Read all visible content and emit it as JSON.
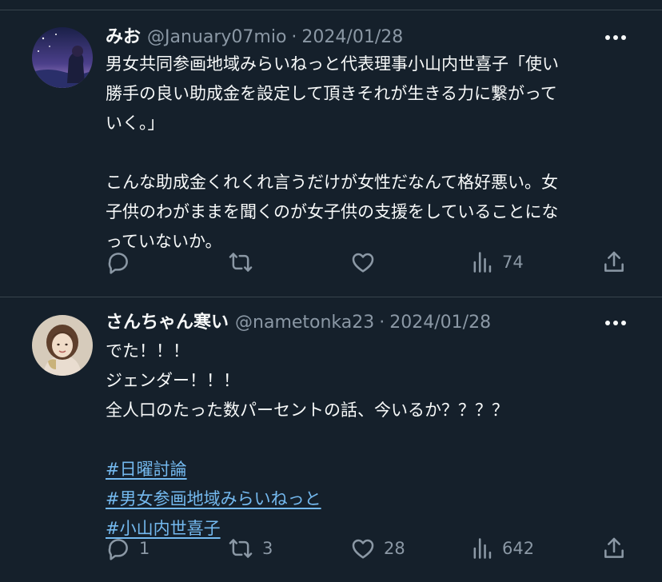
{
  "tweets": [
    {
      "display_name": "みお",
      "handle": "@January07mio",
      "separator": "·",
      "date": "2024/01/28",
      "lines": [
        "男女共同参画地域みらいねっと代表理事小山内世喜子「使い",
        "勝手の良い助成金を設定して頂きそれが生きる力に繋がって",
        "いく。」",
        "",
        "こんな助成金くれくれ言うだけが女性だなんて格好悪い。女",
        "子供のわがままを聞くのが女子供の支援をしていることにな",
        "っていないか。"
      ],
      "hashtags": [],
      "stats": {
        "replies": "",
        "retweets": "",
        "likes": "",
        "views": "74"
      },
      "avatar_colors": [
        "#1d2550",
        "#6d5ba6",
        "#c9a0d8"
      ]
    },
    {
      "display_name": "さんちゃん寒い",
      "handle": "@nametonka23",
      "separator": "·",
      "date": "2024/01/28",
      "lines": [
        "でた！！！",
        "ジェンダー！！！",
        "全人口のたった数パーセントの話、今いるか？？？？"
      ],
      "hashtags": [
        "#日曜討論",
        "#男女参画地域みらいねっと",
        "#小山内世喜子"
      ],
      "stats": {
        "replies": "1",
        "retweets": "3",
        "likes": "28",
        "views": "642"
      },
      "avatar_colors": [
        "#d9cfc0",
        "#6b4a34",
        "#f2e6d6"
      ]
    }
  ],
  "icons": {
    "more": "more-horizontal-icon",
    "reply": "reply-icon",
    "retweet": "retweet-icon",
    "like": "heart-icon",
    "views": "views-icon",
    "share": "share-icon"
  },
  "colors": {
    "background": "#15202b",
    "text": "#f7f9f9",
    "secondary": "#8b98a5",
    "hashtag": "#74b9ef",
    "divider": "#38444d"
  }
}
